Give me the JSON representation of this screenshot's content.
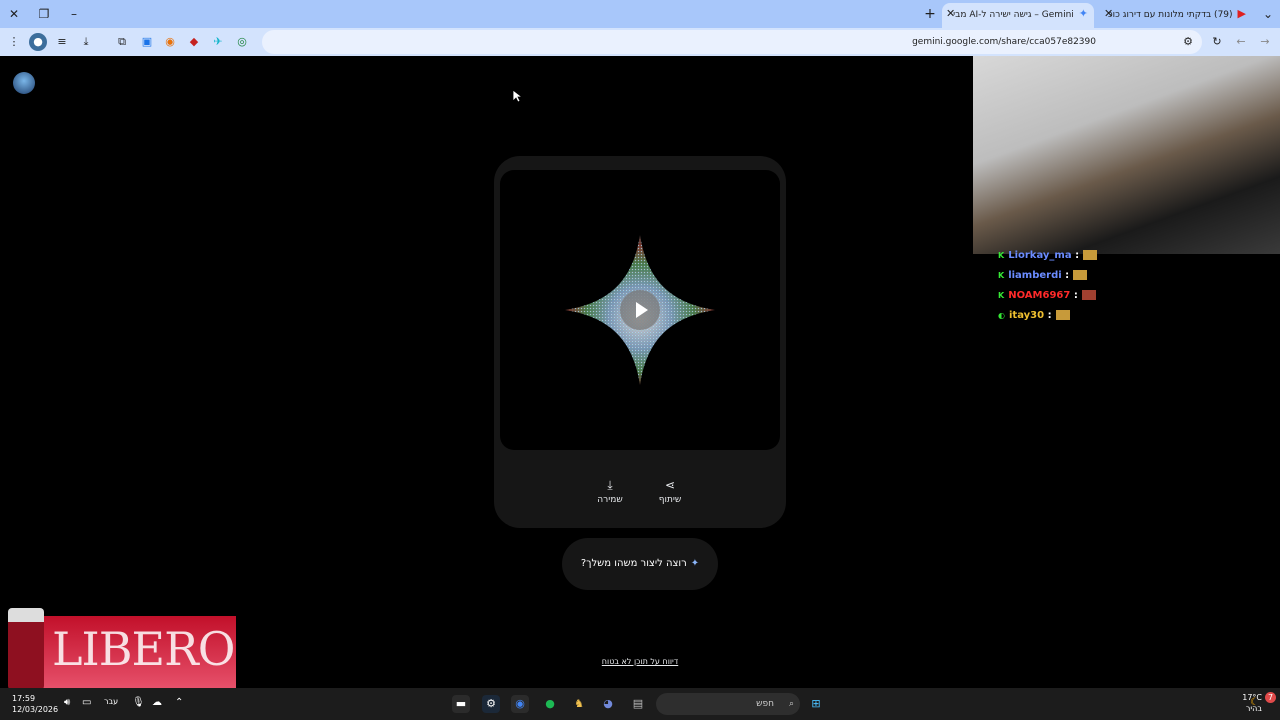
{
  "browser": {
    "tabs": [
      {
        "title": "(79) בדקתי מלונות עם דירוג כוכ",
        "icon": "youtube-icon",
        "active": false
      },
      {
        "title": "Gemini – גישה ישירה ל-AI מבי",
        "icon": "gemini-icon",
        "active": true
      }
    ],
    "url": "gemini.google.com/share/cca057e82390"
  },
  "page": {
    "save_label": "שמירה",
    "share_label": "שיתוף",
    "create_prompt": "רוצה ליצור משהו משלך?",
    "report_link": "דיווח על תוכן לא בטוח"
  },
  "stream": {
    "chat": [
      {
        "user": "Liorkay_ma",
        "color": "#6b8cff"
      },
      {
        "user": "liamberdi",
        "color": "#6b8cff"
      },
      {
        "user": "NOAM6967",
        "color": "#ff2a2a"
      },
      {
        "user": "itay30",
        "color": "#f0c030"
      }
    ],
    "chat_separator": ":",
    "ad_brand": "LIBERO"
  },
  "taskbar": {
    "time": "17:59",
    "date": "12/03/2026",
    "language": "עבר",
    "search_placeholder": "חפש",
    "temperature": "17°C",
    "weather_text": "בהיר",
    "notification_count": "7"
  },
  "colors": {
    "tabstrip": "#a8c7fa",
    "toolbar": "#d3e3fd",
    "page_bg": "#000000",
    "card_bg": "#161616"
  }
}
